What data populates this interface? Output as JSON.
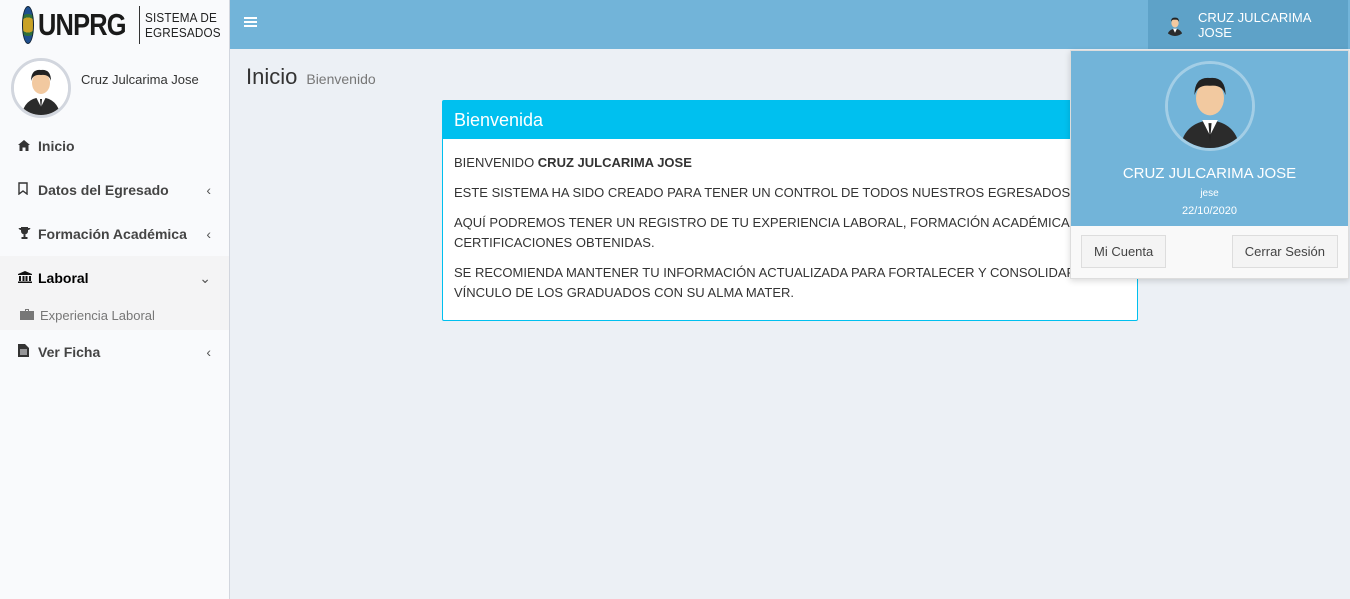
{
  "brand": {
    "name": "UNPRG",
    "subtitle_line1": "SISTEMA DE",
    "subtitle_line2": "EGRESADOS"
  },
  "user": {
    "display_name": "Cruz Julcarima Jose",
    "full_name_upper": "CRUZ JULCARIMA JOSE",
    "username": "jese",
    "date": "22/10/2020"
  },
  "sidebar": {
    "items": [
      {
        "label": "Inicio",
        "icon": "home-icon"
      },
      {
        "label": "Datos del Egresado",
        "icon": "bookmark-icon"
      },
      {
        "label": "Formación Académica",
        "icon": "trophy-icon"
      },
      {
        "label": "Laboral",
        "icon": "bank-icon"
      },
      {
        "label": "Ver Ficha",
        "icon": "file-icon"
      }
    ],
    "submenu": {
      "label": "Experiencia Laboral",
      "icon": "briefcase-icon"
    }
  },
  "header": {
    "user_label": "CRUZ JULCARIMA JOSE"
  },
  "content": {
    "title": "Inicio",
    "subtitle": "Bienvenido"
  },
  "welcome_box": {
    "title": "Bienvenida",
    "greeting_prefix": "BIENVENIDO ",
    "greeting_name": "CRUZ JULCARIMA JOSE",
    "p1": "ESTE SISTEMA HA SIDO CREADO PARA TENER UN CONTROL DE TODOS NUESTROS EGRESADOS.",
    "p2": "AQUÍ PODREMOS TENER UN REGISTRO DE TU EXPERIENCIA LABORAL, FORMACIÓN ACADÉMICA Y CERTIFICACIONES OBTENIDAS.",
    "p3": "SE RECOMIENDA MANTENER TU INFORMACIÓN ACTUALIZADA PARA FORTALECER Y CONSOLIDAR EL VÍNCULO DE LOS GRADUADOS CON SU ALMA MATER."
  },
  "dropdown": {
    "account_button": "Mi Cuenta",
    "logout_button": "Cerrar Sesión"
  },
  "colors": {
    "header": "#72b4d9",
    "box_accent": "#00c0ef",
    "content_bg": "#ecf0f5"
  }
}
